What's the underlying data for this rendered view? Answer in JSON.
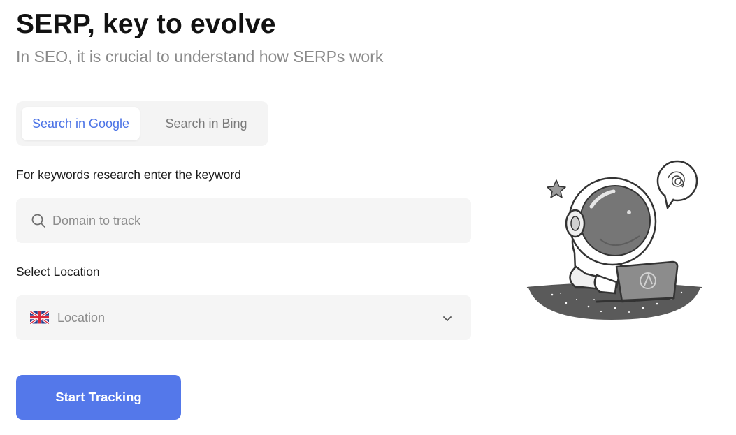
{
  "header": {
    "title": "SERP, key to evolve",
    "subtitle": "In SEO, it is crucial to understand how SERPs work"
  },
  "tabs": [
    {
      "label": "Search in Google",
      "active": true
    },
    {
      "label": "Search in Bing",
      "active": false
    }
  ],
  "keyword": {
    "label": "For keywords research enter the keyword",
    "placeholder": "Domain to track",
    "value": ""
  },
  "location": {
    "label": "Select Location",
    "placeholder": "Location",
    "flag_icon": "uk-flag-icon"
  },
  "actions": {
    "start_label": "Start Tracking"
  },
  "colors": {
    "accent": "#5478ea",
    "active_tab_text": "#4a72e6",
    "field_bg": "#f5f5f5",
    "muted_text": "#8a8a8a"
  },
  "icons": {
    "search": "search-icon",
    "dropdown": "chevron-down-icon",
    "illustration": "astronaut-laptop-illustration"
  }
}
